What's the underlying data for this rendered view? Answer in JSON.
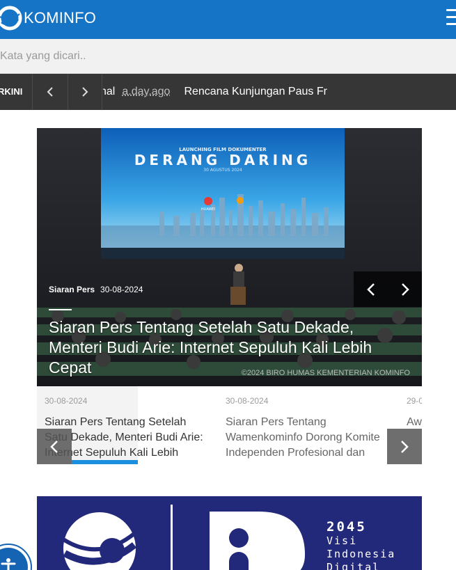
{
  "header": {
    "logo_text": "KOMINFO",
    "brand_color": "#1674c6"
  },
  "search": {
    "placeholder": "Kata yang dicari.."
  },
  "ticker": {
    "label": "RKINI",
    "prev_icon": "chevron-left-icon",
    "next_icon": "chevron-right-icon",
    "items": [
      {
        "title": "nal",
        "time": "a.day.ago"
      },
      {
        "title": "Rencana Kunjungan Paus Fr",
        "time": ""
      }
    ]
  },
  "hero": {
    "category": "Siaran Pers",
    "date": "30-08-2024",
    "title": "Siaran Pers Tentang Setelah Satu Dekade, Menteri Budi Arie: Internet Sepuluh Kali Lebih Cepat",
    "credit": "©2024 BIRO HUMAS KEMENTERIAN KOMINFO",
    "screen_title": "DERANG DARING",
    "screen_subtitle": "LAUNCHING FILM DOKUMENTER",
    "screen_date": "30 AGUSTUS 2024",
    "screen_sponsor": "HUAWEI"
  },
  "cards": [
    {
      "date": "30-08-2024",
      "title": "Siaran Pers Tentang Setelah Satu Dekade, Menteri Budi Arie: Internet Sepuluh Kali Lebih"
    },
    {
      "date": "30-08-2024",
      "title": "Siaran Pers Tentang Wamenkominfo Dorong Komite Independen Profesional dan"
    },
    {
      "date": "29-0",
      "title": "Aw Ko Ka"
    }
  ],
  "banner": {
    "year": "2045",
    "line1": "Visi",
    "line2": "Indonesia",
    "line3": "Digital"
  },
  "accessibility": {
    "icon": "accessibility-icon"
  }
}
